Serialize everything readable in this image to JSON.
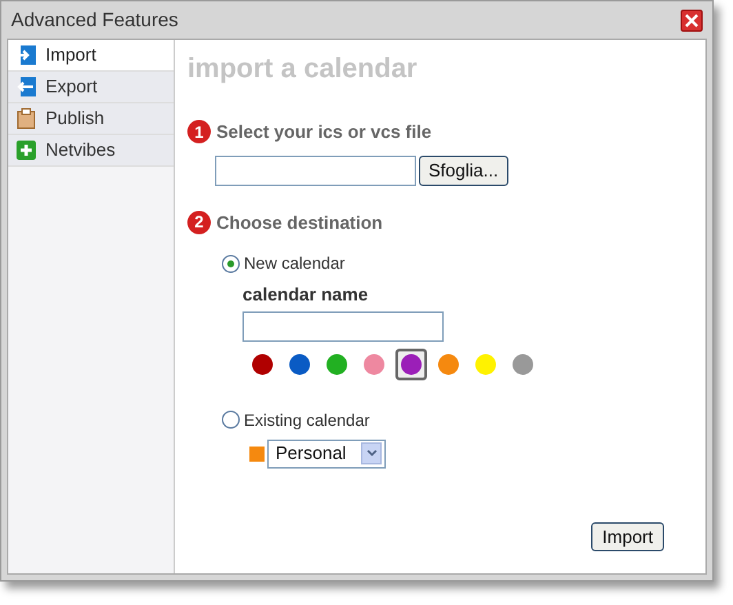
{
  "window": {
    "title": "Advanced Features"
  },
  "sidebar": {
    "items": [
      {
        "label": "Import",
        "selected": true
      },
      {
        "label": "Export",
        "selected": false
      },
      {
        "label": "Publish",
        "selected": false
      },
      {
        "label": "Netvibes",
        "selected": false
      }
    ]
  },
  "heading": "import a calendar",
  "steps": [
    {
      "number": "1",
      "title": "Select your ics or vcs file"
    },
    {
      "number": "2",
      "title": "Choose destination"
    }
  ],
  "browse_button": "Sfoglia...",
  "destinations": [
    {
      "label": "New calendar",
      "selected": true
    },
    {
      "label": "Existing calendar",
      "selected": false
    }
  ],
  "name_label": "calendar name",
  "colors": [
    {
      "color": "#b00000",
      "selected": false
    },
    {
      "color": "#0a5bc4",
      "selected": false
    },
    {
      "color": "#22b022",
      "selected": false
    },
    {
      "color": "#ee88a0",
      "selected": false
    },
    {
      "color": "#9b1fb8",
      "selected": true
    },
    {
      "color": "#f5890f",
      "selected": false
    },
    {
      "color": "#fff200",
      "selected": false
    },
    {
      "color": "#999999",
      "selected": false
    }
  ],
  "existing_calendar": {
    "value": "Personal",
    "color": "#f5890f"
  },
  "import_button": "Import"
}
